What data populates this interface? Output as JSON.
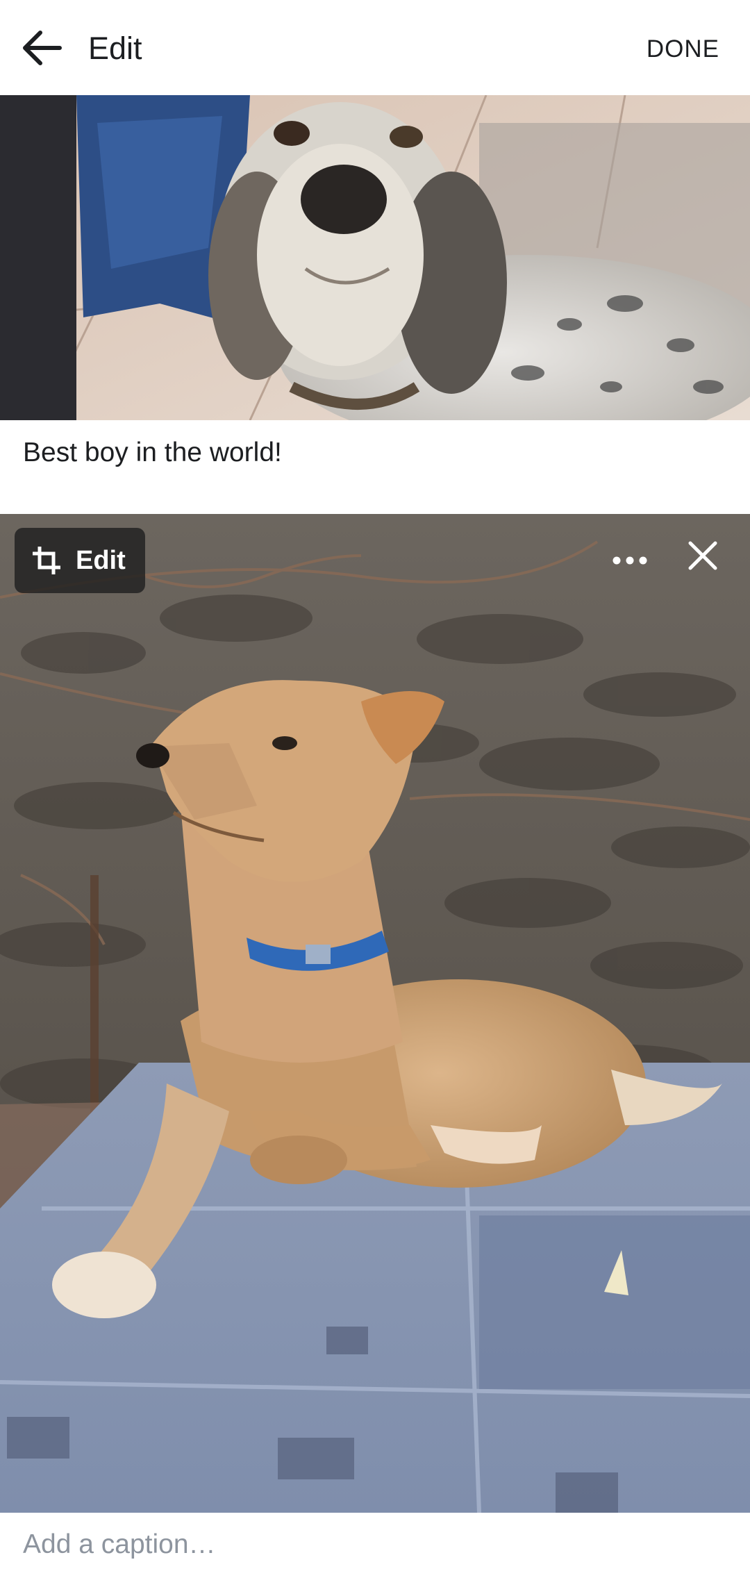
{
  "header": {
    "back_icon": "arrow-left-icon",
    "title": "Edit",
    "done_label": "DONE"
  },
  "posts": [
    {
      "image": "english-setter-dog-photo",
      "caption": "Best boy in the world!"
    },
    {
      "image": "tan-dog-blue-collar-photo",
      "edit_label": "Edit",
      "edit_icon": "crop-icon",
      "more_icon": "more-dots-icon",
      "remove_icon": "close-icon",
      "caption_placeholder": "Add a caption…"
    }
  ]
}
